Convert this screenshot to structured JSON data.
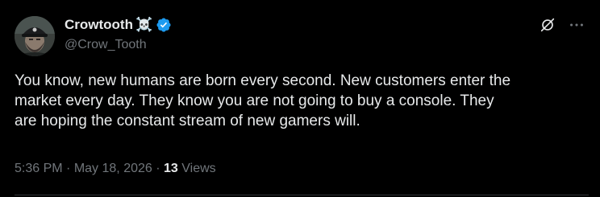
{
  "author": {
    "display_name": "Crowtooth",
    "name_emoji": "☠️",
    "handle": "@Crow_Tooth",
    "verified": true,
    "verified_color": "#1d9bf0",
    "avatar_icon": "avatar-photo"
  },
  "header_actions": {
    "grok_icon": "grok-icon",
    "more_icon": "more-icon"
  },
  "tweet": {
    "text_lines": [
      "You know, new humans are born every second. New customers enter the",
      "market every day. They know you are not going to buy a console. They",
      "are hoping the constant stream of new gamers will."
    ]
  },
  "meta": {
    "time": "5:36 PM",
    "separator": "·",
    "date": "May 18, 2026",
    "views_count": "13",
    "views_label": "Views"
  },
  "colors": {
    "background": "#000000",
    "primary_text": "#e7e9ea",
    "secondary_text": "#71767b",
    "divider": "#2f3336"
  }
}
